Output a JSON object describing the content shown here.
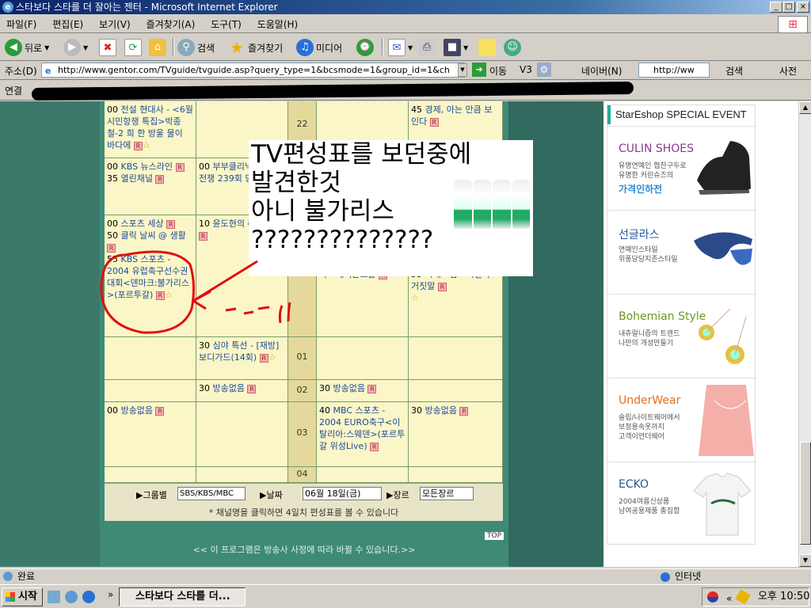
{
  "window": {
    "title": "스타보다 스타를 더 잘아는 젠터 - Microsoft Internet Explorer",
    "min_label": "_",
    "max_label": "□",
    "close_label": "×"
  },
  "menu": [
    "파일(F)",
    "편집(E)",
    "보기(V)",
    "즐겨찾기(A)",
    "도구(T)",
    "도움말(H)"
  ],
  "toolbar": {
    "back_label": "뒤로",
    "search_label": "검색",
    "favorites_label": "즐겨찾기",
    "media_label": "미디어"
  },
  "address": {
    "label": "주소(D)",
    "url": "http://www.gentor.com/TVguide/tvguide.asp?query_type=1&bcsmode=1&group_id=1&ch",
    "go_label": "이동",
    "v3_label": "V3",
    "naver_label": "네이버(N)",
    "naver_url": "http://ww",
    "search_label": "검색",
    "dict_label": "사전"
  },
  "links": {
    "label": "연결"
  },
  "schedule": {
    "hours": [
      "22",
      "",
      "",
      "01",
      "02",
      "03",
      "04"
    ],
    "cells": [
      {
        "time": "00",
        "text": "전설 현대사 - <6월 시민항쟁 특집>박종철-2 희 한 방울 물이 바다에"
      },
      {
        "time": "45",
        "text": "경제, 아는 만큼 보인다"
      },
      {
        "time": "00",
        "text": "KBS 뉴스라인"
      },
      {
        "time": "35",
        "text": "열린채널"
      },
      {
        "time": "00",
        "text": "부부클리닉 사랑과 전쟁 239회 당신"
      },
      {
        "time": "00",
        "text": "스포츠 세상"
      },
      {
        "time": "50",
        "text": "클릭 날씨 @ 생활"
      },
      {
        "time": "10",
        "text": "윤도현의 러브레터"
      },
      {
        "time": "55",
        "text": "KBS 스포츠 - 2004 유럽축구선수권대회<덴마크:불가리스>(포르투갈)"
      },
      {
        "time": "",
        "text": "국 - 에어콘트롤"
      },
      {
        "time": "55",
        "text": "시대 - 감 - 비밀과 거짓말"
      },
      {
        "time": "30",
        "text": "심야 특선 - [재방]보디가드(14회)"
      },
      {
        "time": "30",
        "text": "방송없음"
      },
      {
        "time": "30",
        "text": "방송없음"
      },
      {
        "time": "00",
        "text": "방송없음"
      },
      {
        "time": "40",
        "text": "MBC 스포츠 - 2004 EURO축구<이탈리아:스웨덴>(포르투갈 위성Live)"
      },
      {
        "time": "30",
        "text": "방송없음"
      }
    ],
    "badge": "R",
    "ctrl": {
      "group_label": "▶그룹별",
      "group_value": "SBS/KBS/MBC",
      "date_label": "▶날짜",
      "date_value": "06월 18일(금)",
      "genre_label": "▶장르",
      "genre_value": "모든장르",
      "note": "* 채널명을 클릭하면 4일치 편성표를 볼 수 있습니다"
    },
    "top_label": "TOP",
    "footer": "<< 이 프로그램은 방송사 사정에 따라 바뀔 수 있습니다.>>"
  },
  "sticker": {
    "lines": [
      "TV편성표를 보던중에",
      "발견한것",
      "아니 불가리스",
      "??????????????"
    ]
  },
  "annotation": {
    "scribble": "- - - ll"
  },
  "event": {
    "header": "StarEshop SPECIAL EVENT",
    "items": [
      {
        "title": "CULIN SHOES",
        "sub": [
          "유명연예인 협찬구두로",
          "유명한 커린슈즈의"
        ],
        "tag": "가격인하전",
        "color": "#8a3a8a"
      },
      {
        "title": "선글라스",
        "sub": [
          "연예인스타일",
          "위풍당당지존스타일"
        ],
        "tag": "",
        "color": "#2a5aa0"
      },
      {
        "title": "Bohemian Style",
        "sub": [
          "내츄럴니즘의 트렌드",
          "나만의 개성만들기"
        ],
        "tag": "",
        "color": "#6a9a20"
      },
      {
        "title": "UnderWear",
        "sub": [
          "슬립/나이트웨어에서",
          "보정용속옷까지",
          "고객이언더웨어"
        ],
        "tag": "",
        "color": "#e07020"
      },
      {
        "title": "ECKO",
        "sub": [
          "2004여름신상품",
          "남여공용제품 총집합"
        ],
        "tag": "",
        "color": "#2a5a8a"
      }
    ]
  },
  "status": {
    "text": "완료",
    "zone": "인터넷"
  },
  "taskbar": {
    "start": "시작",
    "item": "스타보다 스타를 더...",
    "clock": "오후 10:50"
  }
}
